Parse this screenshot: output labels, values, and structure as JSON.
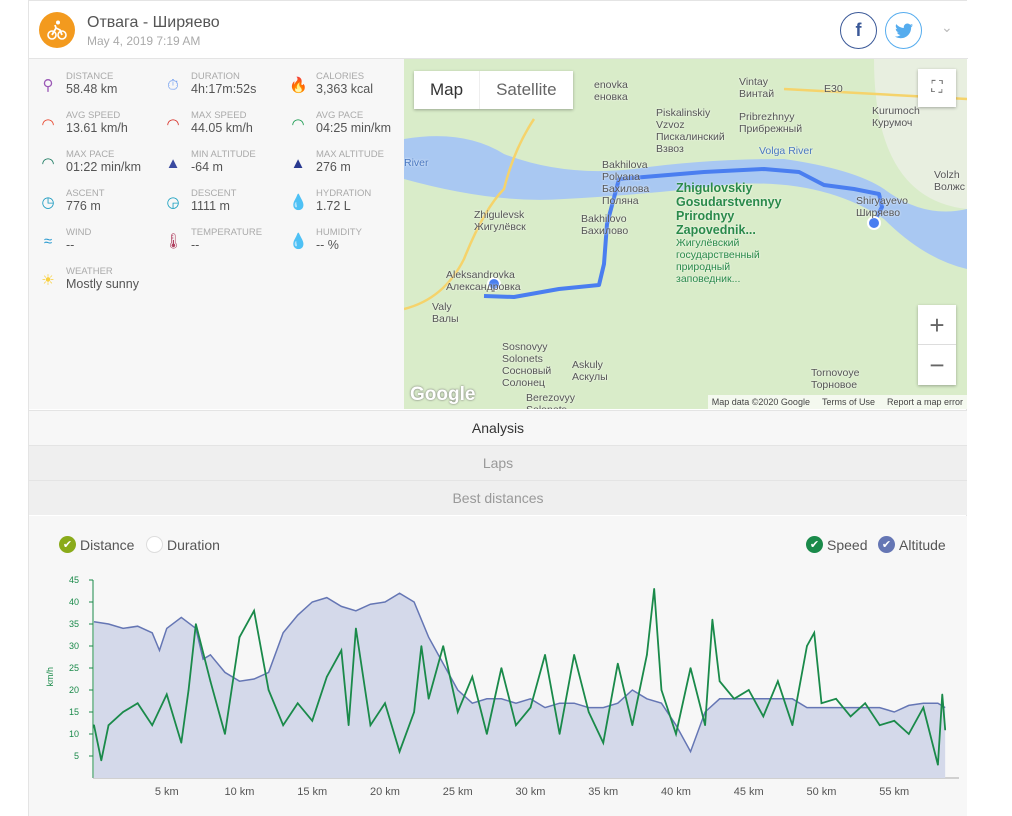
{
  "header": {
    "title": "Отвага - Ширяево",
    "date": "May 4, 2019 7:19 AM",
    "activity_icon": "bicycle-icon",
    "accent": "#f39a1e",
    "facebook": "f",
    "twitter": "twitter-bird"
  },
  "stats": [
    {
      "label": "DISTANCE",
      "value": "58.48 km",
      "icon": "map-pins-icon",
      "color": "#9b59b6"
    },
    {
      "label": "DURATION",
      "value": "4h:17m:52s",
      "icon": "stopwatch-icon",
      "color": "#6e9cf0"
    },
    {
      "label": "CALORIES",
      "value": "3,363 kcal",
      "icon": "flame-icon",
      "color": "#f26c3c"
    },
    {
      "label": "AVG SPEED",
      "value": "13.61 km/h",
      "icon": "speedometer-icon",
      "color": "#e8452c"
    },
    {
      "label": "MAX SPEED",
      "value": "44.05 km/h",
      "icon": "speedometer-icon",
      "color": "#d8322a"
    },
    {
      "label": "AVG PACE",
      "value": "04:25 min/km",
      "icon": "speedometer-icon",
      "color": "#1a9a50"
    },
    {
      "label": "MAX PACE",
      "value": "01:22 min/km",
      "icon": "speedometer-icon",
      "color": "#1a7a60"
    },
    {
      "label": "MIN ALTITUDE",
      "value": "-64 m",
      "icon": "mountain-icon",
      "color": "#3a4aa0"
    },
    {
      "label": "MAX ALTITUDE",
      "value": "276 m",
      "icon": "mountain-icon",
      "color": "#2a3a90"
    },
    {
      "label": "ASCENT",
      "value": "776 m",
      "icon": "ascent-compass-icon",
      "color": "#1a9ac0"
    },
    {
      "label": "DESCENT",
      "value": "1111 m",
      "icon": "descent-compass-icon",
      "color": "#1aa0c0"
    },
    {
      "label": "HYDRATION",
      "value": "1.72 L",
      "icon": "drops-icon",
      "color": "#8ab4f8"
    },
    {
      "label": "WIND",
      "value": "--",
      "icon": "wind-icon",
      "color": "#2a9ad0"
    },
    {
      "label": "TEMPERATURE",
      "value": "--",
      "icon": "thermometer-icon",
      "color": "#b04060"
    },
    {
      "label": "HUMIDITY",
      "value": "-- %",
      "icon": "drops-icon",
      "color": "#8ab4f8"
    },
    {
      "label": "WEATHER",
      "value": "Mostly sunny",
      "icon": "sun-icon",
      "color": "#f8d040"
    }
  ],
  "map": {
    "map_label": "Map",
    "satellite_label": "Satellite",
    "zoom_in": "+",
    "zoom_out": "−",
    "google": "Google",
    "attribution": [
      "Map data ©2020 Google",
      "Terms of Use",
      "Report a map error"
    ],
    "labels": [
      "Vintay\nВинтай",
      "E30",
      "Kurumoch\nКурумоч",
      "Piskalinskiy\nVzvoz\nПискалинский\nВзвоз",
      "Pribrezhnyy\nПрибрежный",
      "Volga River",
      "Bakhilova\nPolyana\nБахилова\nПоляна",
      "Zhigulovskiy\nGosudarstvennyy\nPrirodnyy\nZapovednik...",
      "Жигулёвский\nгосударственный\nприродный\nзаповедник...",
      "Shiryayevo\nШиряево",
      "Zhigulevsk\nЖигулёвск",
      "Bakhilovo\nБахилово",
      "Aleksandrovka\nАлександровка",
      "Valy\nВалы",
      "Sosnovyy\nSolonets\nСосновый\nСолонец",
      "Askuly\nАскулы",
      "Tornovoye\nТорновое",
      "Berezovyy\nSolonets",
      "River",
      "Volzh\nВолжс",
      "enovka\nеновка"
    ]
  },
  "tabs": [
    "Analysis",
    "Laps",
    "Best distances"
  ],
  "chart_data": {
    "type": "line",
    "legend_left": [
      {
        "label": "Distance",
        "checked": true,
        "color": "#8aab1a"
      },
      {
        "label": "Duration",
        "checked": false,
        "color": "#ffffff"
      }
    ],
    "legend_right": [
      {
        "label": "Speed",
        "checked": true,
        "color": "#1a8a4a"
      },
      {
        "label": "Altitude",
        "checked": true,
        "color": "#6576b4"
      }
    ],
    "ylabel": "km/h",
    "ylim": [
      0,
      45
    ],
    "yticks": [
      5,
      10,
      15,
      20,
      25,
      30,
      35,
      40,
      45
    ],
    "xlim": [
      0,
      58.5
    ],
    "xticks": [
      "5 km",
      "10 km",
      "15 km",
      "20 km",
      "25 km",
      "30 km",
      "35 km",
      "40 km",
      "45 km",
      "50 km",
      "55 km"
    ],
    "series": [
      {
        "name": "Speed",
        "color": "#1a8a4a",
        "type": "line",
        "x": [
          0,
          0.5,
          1,
          2,
          3,
          4,
          5,
          6,
          6.5,
          7,
          8,
          9,
          10,
          11,
          12,
          13,
          14,
          15,
          16,
          17,
          17.5,
          18,
          19,
          20,
          21,
          22,
          22.5,
          23,
          24,
          25,
          26,
          27,
          28,
          29,
          30,
          31,
          32,
          33,
          34,
          35,
          36,
          37,
          38,
          38.5,
          39,
          40,
          41,
          42,
          42.5,
          43,
          44,
          45,
          46,
          47,
          48,
          49,
          49.5,
          50,
          51,
          52,
          53,
          54,
          55,
          56,
          57,
          58,
          58.3,
          58.5
        ],
        "values": [
          12,
          4,
          12,
          15,
          17,
          12,
          19,
          8,
          20,
          35,
          22,
          10,
          32,
          38,
          20,
          12,
          17,
          13,
          23,
          29,
          12,
          34,
          12,
          17,
          6,
          15,
          30,
          18,
          30,
          15,
          23,
          10,
          25,
          12,
          16,
          28,
          10,
          28,
          15,
          8,
          26,
          12,
          28,
          43,
          20,
          10,
          25,
          12,
          36,
          22,
          18,
          20,
          14,
          22,
          12,
          30,
          33,
          17,
          18,
          14,
          17,
          12,
          13,
          10,
          16,
          3,
          19,
          11
        ]
      },
      {
        "name": "Altitude",
        "color": "#6576b4",
        "type": "area",
        "x": [
          0,
          1,
          2,
          3,
          4,
          4.5,
          5,
          6,
          7,
          7.5,
          8,
          9,
          10,
          11,
          12,
          13,
          14,
          15,
          16,
          17,
          18,
          19,
          20,
          21,
          22,
          23,
          24,
          25,
          26,
          27,
          28,
          29,
          30,
          31,
          32,
          33,
          34,
          35,
          36,
          37,
          38,
          39,
          40,
          41,
          42,
          43,
          44,
          45,
          46,
          47,
          48,
          49,
          50,
          51,
          52,
          53,
          54,
          55,
          56,
          57,
          58,
          58.5
        ],
        "values": [
          35.5,
          35,
          34,
          34.5,
          33,
          29,
          34,
          36.5,
          34,
          27,
          28,
          24,
          22,
          22.5,
          24,
          33,
          37,
          40,
          41,
          39,
          38,
          39.5,
          40,
          42,
          40,
          32,
          26,
          20,
          17,
          18,
          18,
          17,
          18,
          16,
          17,
          17,
          16,
          16,
          17,
          20,
          18,
          17,
          12,
          6,
          15,
          18,
          18,
          18,
          18,
          18,
          18,
          16,
          16,
          16,
          16,
          16,
          16,
          15,
          16.5,
          17,
          17,
          16
        ]
      }
    ]
  }
}
